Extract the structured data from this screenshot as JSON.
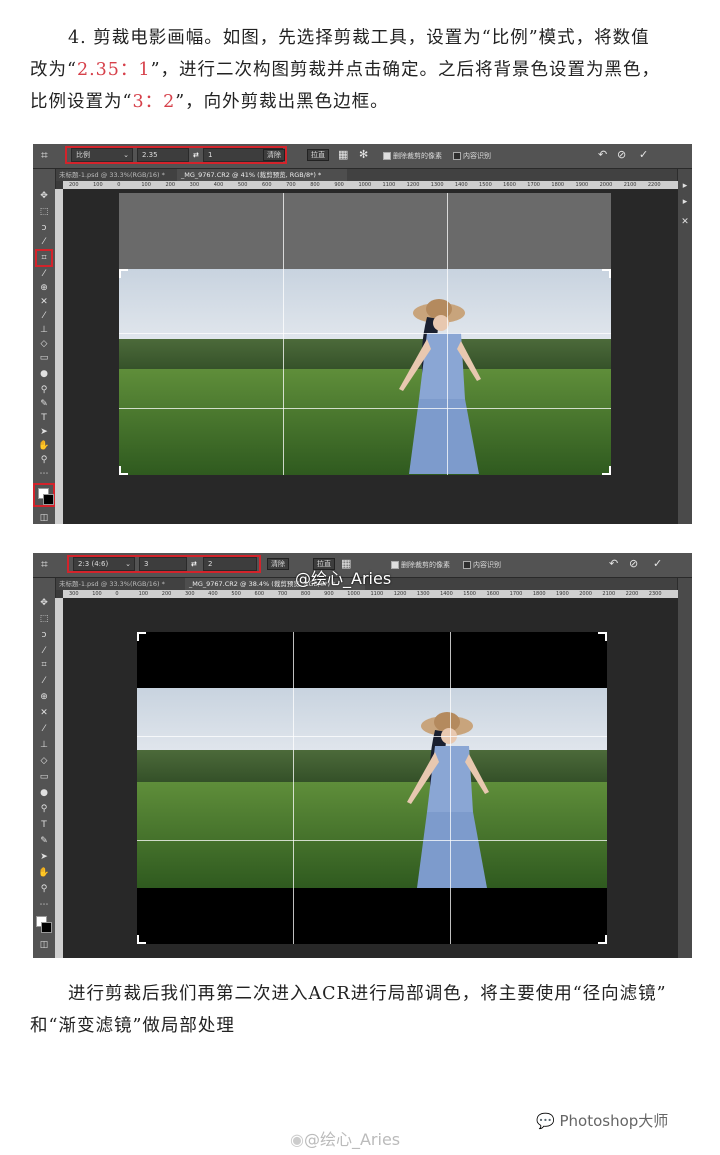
{
  "intro": {
    "line1": "4. 剪裁电影画幅。如图，先选择剪裁工具，设置为“比例”模式，将数值",
    "line2_a": "改为“",
    "line2_hl": "2.35：1",
    "line2_b": "”，进行二次构图剪裁并点击确定。之后将背景色设置为黑色，",
    "line3_a": "比例设置为“",
    "line3_hl": "3：2",
    "line3_b": "”，向外剪裁出黑色边框。"
  },
  "screenshot1": {
    "ratio_select": "比例",
    "width_value": "2.35",
    "swap_icon": "⇄",
    "height_value": "1",
    "clear_btn": "清除",
    "straighten": "拉直",
    "delete_pixels": "删除裁剪的像素",
    "content_aware": "内容识别",
    "tab1": "未标题-1.psd @ 33.3%(RGB/16) *",
    "tab2": "_MG_9767.CR2 @ 41% (裁剪预览, RGB/8*) *",
    "ruler": [
      "200",
      "100",
      "0",
      "100",
      "200",
      "300",
      "400",
      "500",
      "600",
      "700",
      "800",
      "900",
      "1000",
      "1100",
      "1200",
      "1300",
      "1400",
      "1500",
      "1600",
      "1700",
      "1800",
      "1900",
      "2000",
      "2100",
      "2200"
    ]
  },
  "screenshot2": {
    "ratio_select": "2:3 (4:6)",
    "width_value": "3",
    "swap_icon": "⇄",
    "height_value": "2",
    "clear_btn": "清除",
    "straighten": "拉直",
    "delete_pixels": "删除裁剪的像素",
    "content_aware": "内容识别",
    "tab1": "未标题-1.psd @ 33.3%(RGB/16) *",
    "tab2": "_MG_9767.CR2 @ 38.4% (裁剪预览, RGB/8*) *",
    "overlay_watermark": "@绘心_Aries",
    "ruler": [
      "300",
      "100",
      "0",
      "100",
      "200",
      "300",
      "400",
      "500",
      "600",
      "700",
      "800",
      "900",
      "1000",
      "1100",
      "1200",
      "1300",
      "1400",
      "1500",
      "1600",
      "1700",
      "1800",
      "1900",
      "2000",
      "2100",
      "2200",
      "2300"
    ]
  },
  "outro": {
    "line1": "进行剪裁后我们再第二次进入ACR进行局部调色，将主要使用“径向滤镜”",
    "line2": "和“渐变滤镜”做局部处理"
  },
  "footer": {
    "weibo_watermark": "@绘心_Aries",
    "brand": "Photoshop大师"
  },
  "colors": {
    "highlight": "#d6404a",
    "red_box": "#d3232b",
    "ps_bg": "#3a3a3a"
  }
}
